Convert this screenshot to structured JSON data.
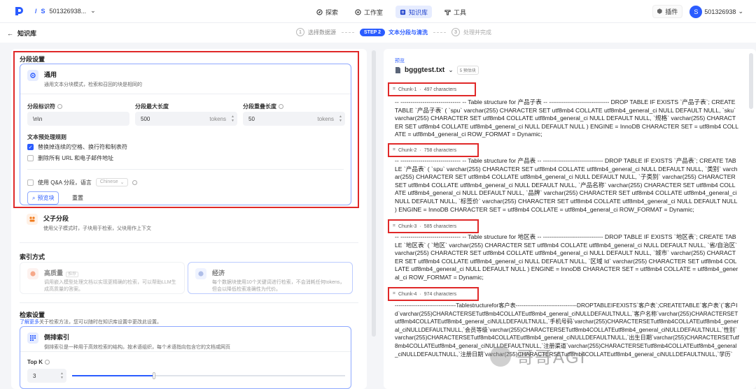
{
  "topbar": {
    "workspace": "501326938...",
    "nav": [
      {
        "label": "探索",
        "icon": "explore-icon"
      },
      {
        "label": "工作室",
        "icon": "studio-icon"
      },
      {
        "label": "知识库",
        "icon": "knowledge-icon"
      },
      {
        "label": "工具",
        "icon": "tools-icon"
      }
    ],
    "plugin_label": "插件",
    "avatar_letter": "S",
    "user_name": "501326938"
  },
  "subbar": {
    "back_label": "知识库",
    "steps": [
      {
        "num": "1",
        "label": "选择数据源"
      },
      {
        "num": "STEP 2",
        "label": "文本分段与清洗"
      },
      {
        "num": "3",
        "label": "处理并完成"
      }
    ]
  },
  "left": {
    "segment_title": "分段设置",
    "general": {
      "title": "通用",
      "desc": "通用文本分块模式，检索和召回的块是相同的"
    },
    "fields": {
      "delimiter_label": "分段标识符",
      "delimiter_value": "\\n\\n",
      "maxlen_label": "分段最大长度",
      "maxlen_value": "500",
      "maxlen_unit": "tokens",
      "overlap_label": "分段重叠长度",
      "overlap_value": "50",
      "overlap_unit": "tokens"
    },
    "preprocess": {
      "title": "文本预处理规则",
      "rule1": "替换掉连续的空格、换行符和制表符",
      "rule2": "删除所有 URL 和电子邮件地址"
    },
    "qa": {
      "label": "使用 Q&A 分段，语言",
      "lang": "Chinese"
    },
    "preview_btn": "预览块",
    "reset_btn": "重置",
    "parent_child": {
      "title": "父子分段",
      "desc": "使用父子模式时，子块用于检索，父块用作上下文"
    },
    "index_title": "索引方式",
    "index_hq": {
      "title": "高质量",
      "tag": "推荐",
      "desc": "调用嵌入模型处理文档以实现更精确的检索，可以帮助LLM生成高质量的答案。"
    },
    "index_eco": {
      "title": "经济",
      "desc": "每个数据块使用10个关键词进行检索，不会消耗任何tokens，但会以降低检索准确性为代价。"
    },
    "retrieval_title": "检索设置",
    "retrieval_link": "了解更多",
    "retrieval_desc": "关于检索方法，您可以随时在知识库设置中更改此设置。",
    "inverted": {
      "title": "倒排索引",
      "desc": "倒排索引是一种用于高效检索的结构。按术语组织，每个术语指向包含它的文档或网页"
    },
    "topk_label": "Top K",
    "topk_value": "3",
    "topk_fraction": 0.3
  },
  "right": {
    "preview_label": "预览",
    "file_name": "bgggtest.txt",
    "estimate_badge": "5 预估块",
    "chunks": [
      {
        "id": "Chunk-1",
        "chars": "497 characters",
        "text": "-- ------------------------------ -- Table structure for 产品子表 -- ------------------------------ DROP TABLE IF EXISTS `产品子表`; CREATE TABLE `产品子表` ( `spu` varchar(255) CHARACTER SET utf8mb4 COLLATE utf8mb4_general_ci NULL DEFAULT NULL, `sku` varchar(255) CHARACTER SET utf8mb4 COLLATE utf8mb4_general_ci NULL DEFAULT NULL, `规格` varchar(255) CHARACTER SET utf8mb4 COLLATE utf8mb4_general_ci NULL DEFAULT NULL ) ENGINE = InnoDB CHARACTER SET = utf8mb4 COLLATE = utf8mb4_general_ci ROW_FORMAT = Dynamic;"
      },
      {
        "id": "Chunk-2",
        "chars": "758 characters",
        "text": "-- ------------------------------ -- Table structure for 产品表 -- ------------------------------ DROP TABLE IF EXISTS `产品表`; CREATE TABLE `产品表` ( `spu` varchar(255) CHARACTER SET utf8mb4 COLLATE utf8mb4_general_ci NULL DEFAULT NULL, `类别` varchar(255) CHARACTER SET utf8mb4 COLLATE utf8mb4_general_ci NULL DEFAULT NULL, `子类别` varchar(255) CHARACTER SET utf8mb4 COLLATE utf8mb4_general_ci NULL DEFAULT NULL, `产品名称` varchar(255) CHARACTER SET utf8mb4 COLLATE utf8mb4_general_ci NULL DEFAULT NULL, `品牌` varchar(255) CHARACTER SET utf8mb4 COLLATE utf8mb4_general_ci NULL DEFAULT NULL, `标签价` varchar(255) CHARACTER SET utf8mb4 COLLATE utf8mb4_general_ci NULL DEFAULT NULL ) ENGINE = InnoDB CHARACTER SET = utf8mb4 COLLATE = utf8mb4_general_ci ROW_FORMAT = Dynamic;"
      },
      {
        "id": "Chunk-3",
        "chars": "585 characters",
        "text": "-- ------------------------------ -- Table structure for 地区表 -- ------------------------------ DROP TABLE IF EXISTS `地区表`; CREATE TABLE `地区表` ( `地区` varchar(255) CHARACTER SET utf8mb4 COLLATE utf8mb4_general_ci NULL DEFAULT NULL, `省/自治区` varchar(255) CHARACTER SET utf8mb4 COLLATE utf8mb4_general_ci NULL DEFAULT NULL, `城市` varchar(255) CHARACTER SET utf8mb4 COLLATE utf8mb4_general_ci NULL DEFAULT NULL, `区域 Id` varchar(255) CHARACTER SET utf8mb4 COLLATE utf8mb4_general_ci NULL DEFAULT NULL ) ENGINE = InnoDB CHARACTER SET = utf8mb4 COLLATE = utf8mb4_general_ci ROW_FORMAT = Dynamic;"
      },
      {
        "id": "Chunk-4",
        "chars": "974 characters",
        "text": "--------------------------------Tablestructurefor客户表--------------------------------DROPTABLEIFEXISTS`客户表`;CREATETABLE`客户表`(`客户Id`varchar(255)CHARACTERSETutf8mb4COLLATEutf8mb4_general_ciNULLDEFAULTNULL,`客户名称`varchar(255)CHARACTERSETutf8mb4COLLATEutf8mb4_general_ciNULLDEFAULTNULL,`手机号码`varchar(255)CHARACTERSETutf8mb4COLLATEutf8mb4_general_ciNULLDEFAULTNULL,`会员等级`varchar(255)CHARACTERSETutf8mb4COLLATEutf8mb4_general_ciNULLDEFAULTNULL,`性别`varchar(255)CHARACTERSETutf8mb4COLLATEutf8mb4_general_ciNULLDEFAULTNULL,`出生日期`varchar(255)CHARACTERSETutf8mb4COLLATEutf8mb4_general_ciNULLDEFAULTNULL,`注册渠道`varchar(255)CHARACTERSETutf8mb4COLLATEutf8mb4_general_ciNULLDEFAULTNULL,`注册日期`varchar(255)CHARACTERSETutf8mb4COLLATEutf8mb4_general_ciNULLDEFAULTNULL,`学历`"
      }
    ]
  },
  "watermark": "哥哥AGI",
  "colors": {
    "accent": "#2b5cff",
    "highlight": "#e02828"
  }
}
